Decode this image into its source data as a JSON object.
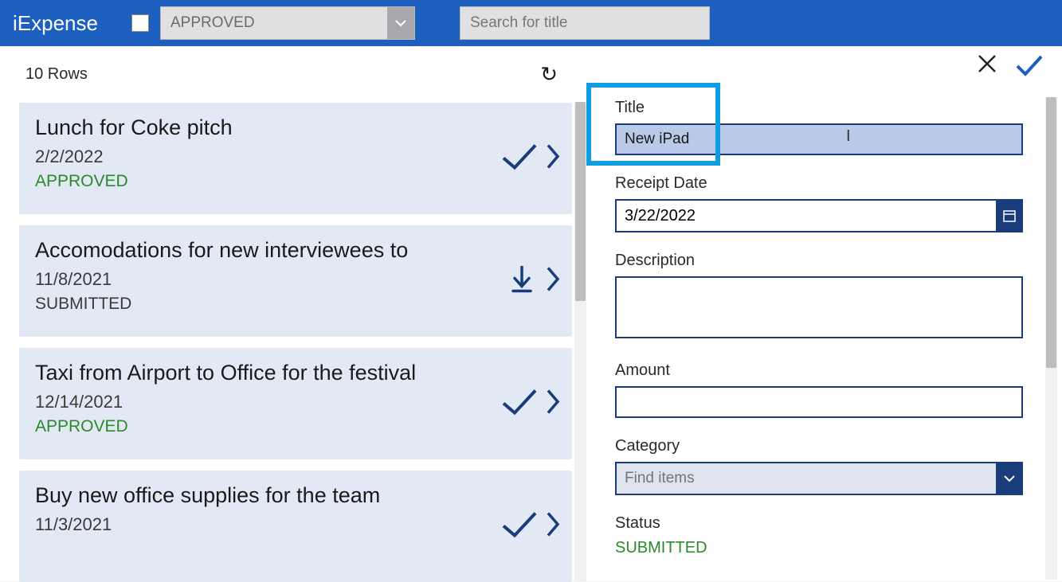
{
  "header": {
    "app_title": "iExpense",
    "filter_value": "APPROVED",
    "search_placeholder": "Search for title"
  },
  "left": {
    "row_count_label": "10 Rows",
    "items": [
      {
        "title": "Lunch for Coke pitch",
        "date": "2/2/2022",
        "status": "APPROVED",
        "status_class": "status-approved",
        "action": "check"
      },
      {
        "title": "Accomodations for new interviewees to",
        "date": "11/8/2021",
        "status": "SUBMITTED",
        "status_class": "status-submitted",
        "action": "download"
      },
      {
        "title": "Taxi from Airport to Office for the festival",
        "date": "12/14/2021",
        "status": "APPROVED",
        "status_class": "status-approved",
        "action": "check"
      },
      {
        "title": "Buy new office supplies for the team",
        "date": "11/3/2021",
        "status": "",
        "status_class": "",
        "action": "check"
      }
    ]
  },
  "form": {
    "title_label": "Title",
    "title_value": "New iPad",
    "date_label": "Receipt Date",
    "date_value": "3/22/2022",
    "desc_label": "Description",
    "desc_value": "",
    "amount_label": "Amount",
    "amount_value": "",
    "category_label": "Category",
    "category_placeholder": "Find items",
    "status_label": "Status",
    "status_value": "SUBMITTED"
  }
}
